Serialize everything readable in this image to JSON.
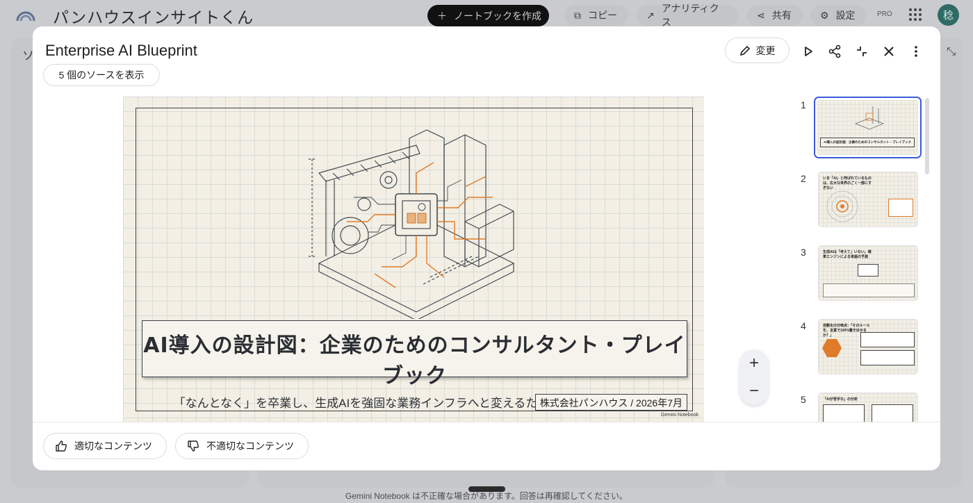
{
  "app": {
    "title": "パンハウスインサイトくん",
    "create_notebook_label": "ノートブックを作成",
    "copy_label": "コピー",
    "analytics_label": "アナリティクス",
    "share_label": "共有",
    "settings_label": "設定",
    "pro_badge": "PRO",
    "avatar_initial": "稔",
    "left_panel_peek": "ソ",
    "footer_disclaimer": "Gemini Notebook は不正確な場合があります。回答は再確認してください。"
  },
  "modal": {
    "title": "Enterprise AI Blueprint",
    "sources_button": "5 個のソースを表示",
    "edit_button": "変更",
    "icons": [
      "play-icon",
      "share-icon",
      "collapse-icon",
      "close-icon",
      "more-vert-icon"
    ]
  },
  "slide": {
    "title": "AI導入の設計図：企業のためのコンサルタント・プレイブック",
    "subtitle": "「なんとなく」を卒業し、生成AIを強固な業務インフラへと変えるための構造的アプローチ",
    "credit": "株式会社パンハウス / 2026年7月",
    "brand": "Gemini Notebook"
  },
  "zoom": {
    "zoom_in": "+",
    "zoom_out": "−"
  },
  "thumbnails": [
    {
      "num": "1",
      "text": "AI導入の設計図：企業のためのコンサルタント・プレイブック",
      "active": true
    },
    {
      "num": "2",
      "text": "いま「AI」と呼ばれているものは、広大な世界のごく一部にすぎない"
    },
    {
      "num": "3",
      "text": "生成AIは「考えて」いない。確率エンジンによる単語の予測"
    },
    {
      "num": "4",
      "text": "自動化の分岐点：「そのルールを、言葉で100%書き出せるか？」"
    },
    {
      "num": "5",
      "text": "「AIが苦手な」の分析"
    }
  ],
  "feedback": {
    "good_label": "適切なコンテンツ",
    "bad_label": "不適切なコンテンツ"
  },
  "colors": {
    "accent": "#3b5bdb",
    "slide_bg": "#f3efe4",
    "orange": "#e07b2a"
  }
}
